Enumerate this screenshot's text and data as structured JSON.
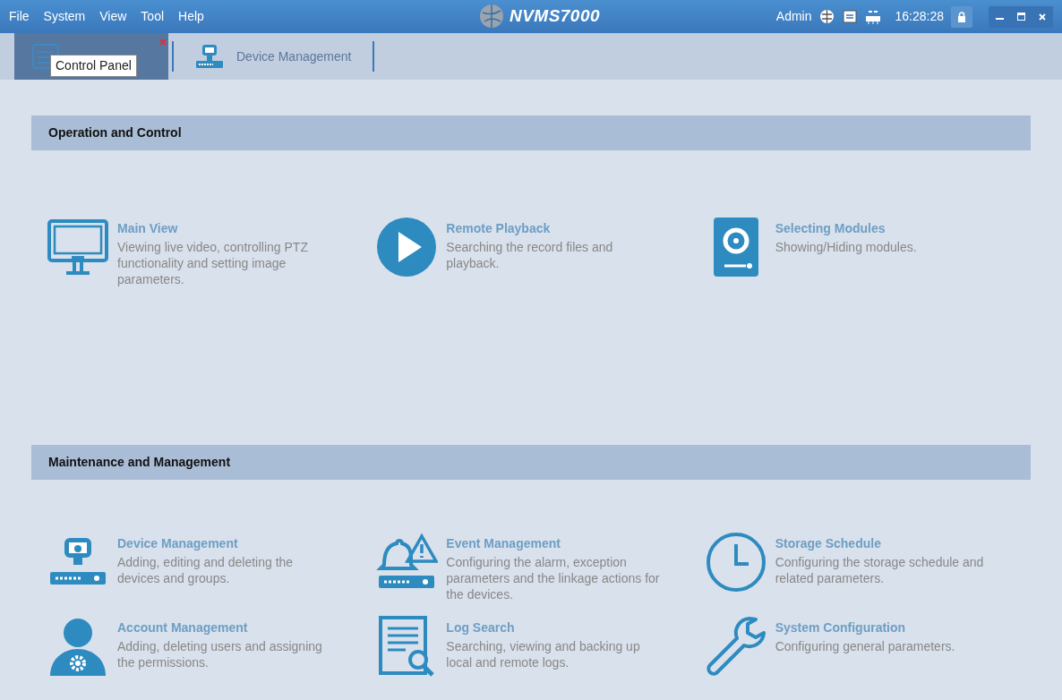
{
  "menu": [
    "File",
    "System",
    "View",
    "Tool",
    "Help"
  ],
  "app_title": "NVMS7000",
  "status": {
    "user": "Admin",
    "time": "16:28:28"
  },
  "tabs": [
    {
      "kind": "control",
      "selected": true,
      "closable": true
    },
    {
      "kind": "device",
      "label": "Device Management",
      "selected": false,
      "closable": false
    }
  ],
  "tooltip": "Control Panel",
  "sections": [
    {
      "title": "Operation and Control",
      "items": [
        {
          "kind": "monitor",
          "title": "Main View",
          "description": "Viewing live video, controlling PTZ functionality and setting image parameters."
        },
        {
          "kind": "play",
          "title": "Remote Playback",
          "description": "Searching the record files and playback."
        },
        {
          "kind": "disk",
          "title": "Selecting Modules",
          "description": "Showing/Hiding modules."
        }
      ]
    },
    {
      "title": "Maintenance and Management",
      "items": [
        {
          "kind": "device",
          "title": "Device Management",
          "description": "Adding, editing and deleting the devices and groups."
        },
        {
          "kind": "event",
          "title": "Event Management",
          "description": "Configuring the alarm, exception parameters and the linkage actions for the devices."
        },
        {
          "kind": "clock",
          "title": "Storage Schedule",
          "description": "Configuring the storage schedule and related parameters."
        },
        {
          "kind": "account",
          "title": "Account Management",
          "description": "Adding, deleting users and assigning the permissions."
        },
        {
          "kind": "log",
          "title": "Log Search",
          "description": "Searching, viewing and backing up local and remote logs."
        },
        {
          "kind": "wrench",
          "title": "System Configuration",
          "description": "Configuring general parameters."
        }
      ]
    }
  ]
}
